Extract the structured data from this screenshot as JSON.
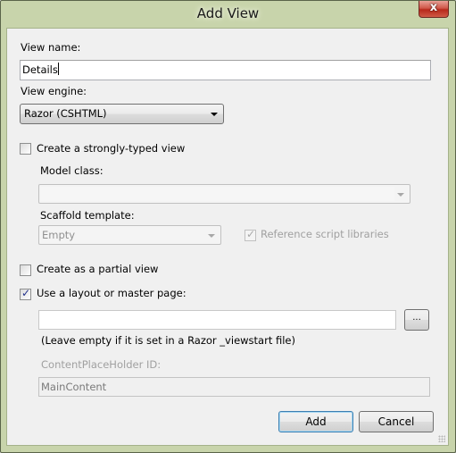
{
  "window": {
    "title": "Add View",
    "close_icon": "close-x-icon"
  },
  "form": {
    "view_name": {
      "label": "View name:",
      "value": "Details"
    },
    "view_engine": {
      "label": "View engine:",
      "selected": "Razor (CSHTML)"
    },
    "strongly_typed": {
      "label": "Create a strongly-typed view",
      "checked": false
    },
    "model_class": {
      "label": "Model class:",
      "value": ""
    },
    "scaffold_template": {
      "label": "Scaffold template:",
      "selected": "Empty"
    },
    "reference_scripts": {
      "label": "Reference script libraries",
      "checked": true,
      "enabled": false
    },
    "partial_view": {
      "label": "Create as a partial view",
      "checked": false
    },
    "use_layout": {
      "label": "Use a layout or master page:",
      "checked": true
    },
    "layout_path": {
      "value": "",
      "browse_label": "...",
      "hint": "(Leave empty if it is set in a Razor _viewstart file)"
    },
    "content_placeholder": {
      "label": "ContentPlaceHolder ID:",
      "value": "MainContent"
    }
  },
  "buttons": {
    "add": "Add",
    "cancel": "Cancel"
  },
  "check_glyph": "✓",
  "close_glyph": "x"
}
